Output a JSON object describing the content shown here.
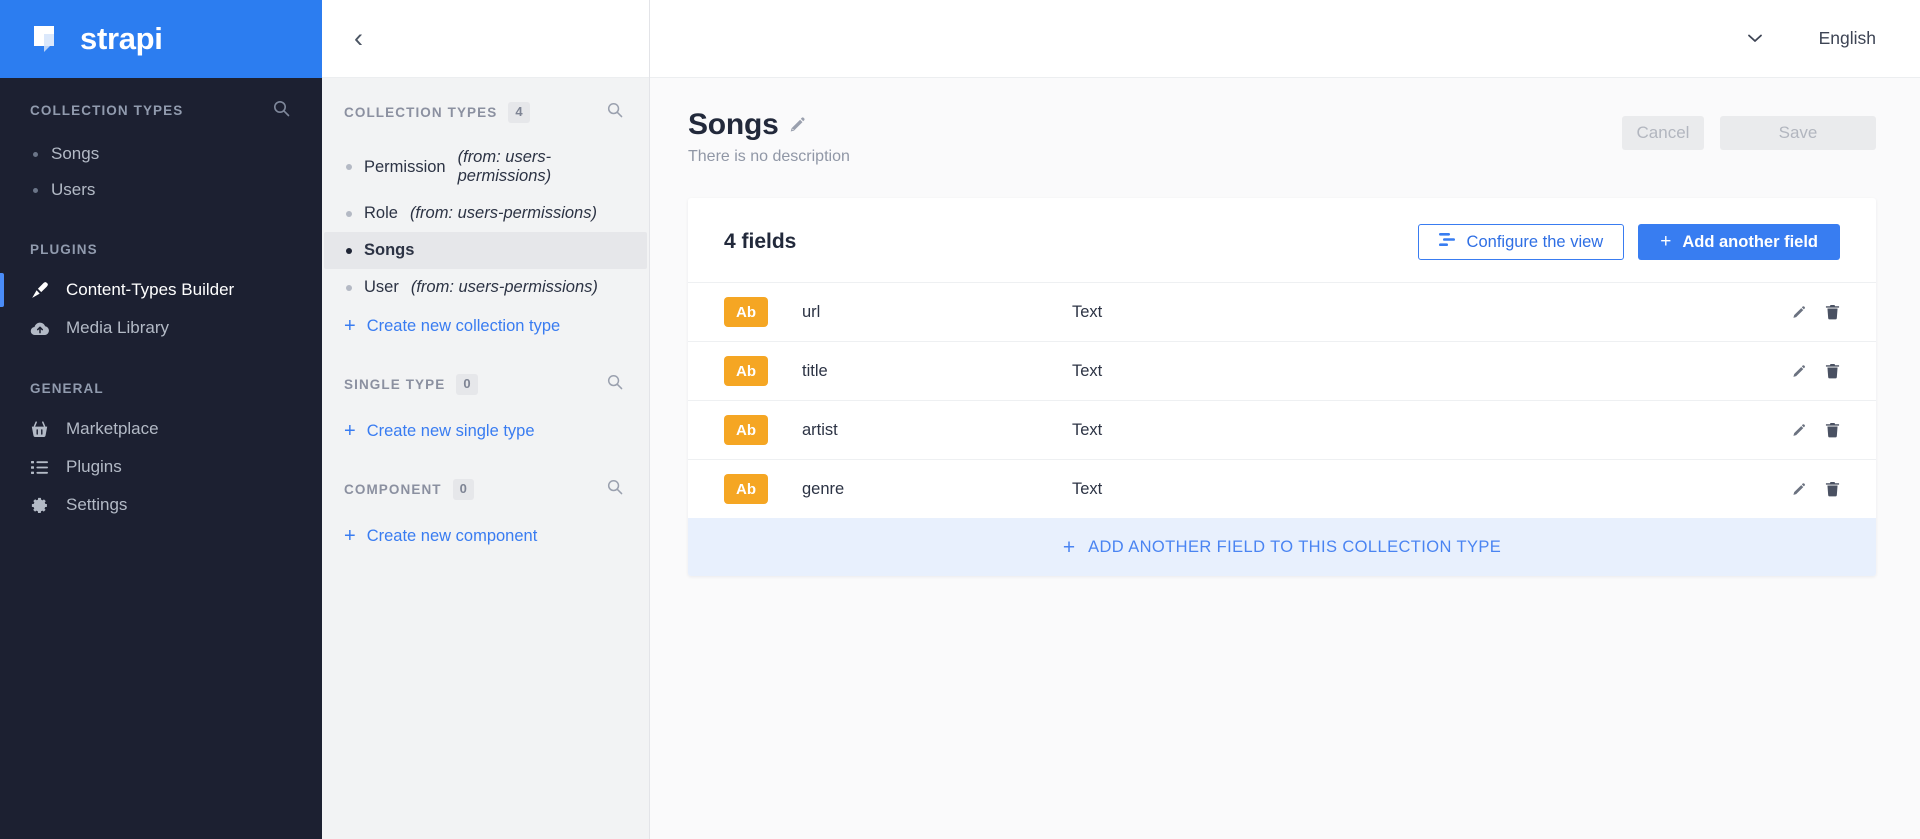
{
  "brand": {
    "name": "strapi",
    "logo_icon": "strapi-logo-icon",
    "color": "#2c7df0"
  },
  "sidebar": {
    "collection_types": {
      "label": "COLLECTION TYPES",
      "search_icon": "search-icon",
      "items": [
        {
          "label": "Songs"
        },
        {
          "label": "Users"
        }
      ]
    },
    "sections": [
      {
        "label": "PLUGINS",
        "items": [
          {
            "label": "Content-Types Builder",
            "icon": "paintbrush-icon",
            "active": true
          },
          {
            "label": "Media Library",
            "icon": "cloud-upload-icon",
            "active": false
          }
        ]
      },
      {
        "label": "GENERAL",
        "items": [
          {
            "label": "Marketplace",
            "icon": "shopping-basket-icon",
            "active": false
          },
          {
            "label": "Plugins",
            "icon": "list-icon",
            "active": false
          },
          {
            "label": "Settings",
            "icon": "gear-icon",
            "active": false
          }
        ]
      }
    ]
  },
  "midpanel": {
    "back_icon": "chevron-left-icon",
    "groups": [
      {
        "title": "COLLECTION TYPES",
        "count": "4",
        "search_icon": "search-icon",
        "items": [
          {
            "name": "Permission",
            "from": "(from: users-permissions)",
            "selected": false
          },
          {
            "name": "Role",
            "from": "(from: users-permissions)",
            "selected": false
          },
          {
            "name": "Songs",
            "from": "",
            "selected": true
          },
          {
            "name": "User",
            "from": "(from: users-permissions)",
            "selected": false
          }
        ],
        "create_label": "Create new collection type"
      },
      {
        "title": "SINGLE TYPE",
        "count": "0",
        "search_icon": "search-icon",
        "items": [],
        "create_label": "Create new single type"
      },
      {
        "title": "COMPONENT",
        "count": "0",
        "search_icon": "search-icon",
        "items": [],
        "create_label": "Create new component"
      }
    ]
  },
  "topbar": {
    "caret_icon": "chevron-down-icon",
    "language": "English"
  },
  "page": {
    "title": "Songs",
    "edit_icon": "pencil-icon",
    "description": "There is no description",
    "cancel_label": "Cancel",
    "save_label": "Save"
  },
  "fields_card": {
    "count_label": "4 fields",
    "configure_label": "Configure the view",
    "configure_icon": "sliders-icon",
    "add_field_label": "Add another field",
    "columns": {
      "name": "",
      "type": ""
    },
    "rows": [
      {
        "badge": "Ab",
        "name": "url",
        "type": "Text",
        "edit_icon": "pencil-icon",
        "delete_icon": "trash-icon"
      },
      {
        "badge": "Ab",
        "name": "title",
        "type": "Text",
        "edit_icon": "pencil-icon",
        "delete_icon": "trash-icon"
      },
      {
        "badge": "Ab",
        "name": "artist",
        "type": "Text",
        "edit_icon": "pencil-icon",
        "delete_icon": "trash-icon"
      },
      {
        "badge": "Ab",
        "name": "genre",
        "type": "Text",
        "edit_icon": "pencil-icon",
        "delete_icon": "trash-icon"
      }
    ],
    "add_bar_label": "ADD ANOTHER FIELD TO THIS COLLECTION TYPE",
    "badge_color": "#f5a623",
    "accent_color": "#387df1"
  }
}
